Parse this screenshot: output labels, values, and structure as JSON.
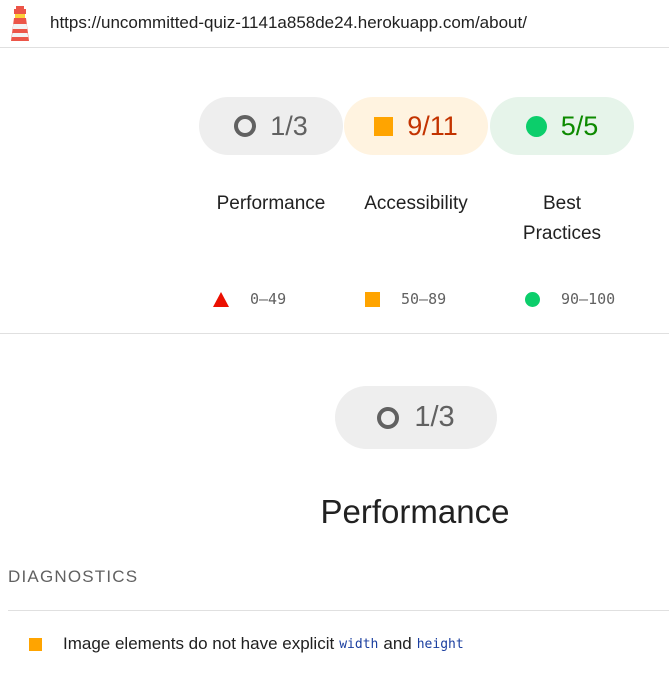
{
  "header": {
    "url": "https://uncommitted-quiz-1141a858de24.herokuapp.com/about/",
    "logo_icon": "lighthouse-icon"
  },
  "scores": [
    {
      "category": "Performance",
      "score": "1/3",
      "rating": "fail",
      "icon": "open-circle-icon",
      "color": "#616161"
    },
    {
      "category": "Accessibility",
      "score": "9/11",
      "rating": "average",
      "icon": "orange-square-icon",
      "color": "#c33300"
    },
    {
      "category": "Best Practices",
      "score": "5/5",
      "rating": "pass",
      "icon": "green-circle-icon",
      "color": "#0d8a00"
    }
  ],
  "labels": {
    "performance": "Performance",
    "accessibility": "Accessibility",
    "best_practices_line1": "Best",
    "best_practices_line2": "Practices"
  },
  "legend": {
    "fail": "0–49",
    "average": "50–89",
    "pass": "90–100"
  },
  "section": {
    "score": "1/3",
    "title": "Performance"
  },
  "diagnostics": {
    "header": "DIAGNOSTICS",
    "items": [
      {
        "text_before": "Image elements do not have explicit",
        "code_1": "width",
        "text_mid": "and",
        "code_2": "height"
      }
    ]
  },
  "colors": {
    "fail": "#eb0f00",
    "average": "#ffa400",
    "pass": "#0cce6b"
  }
}
